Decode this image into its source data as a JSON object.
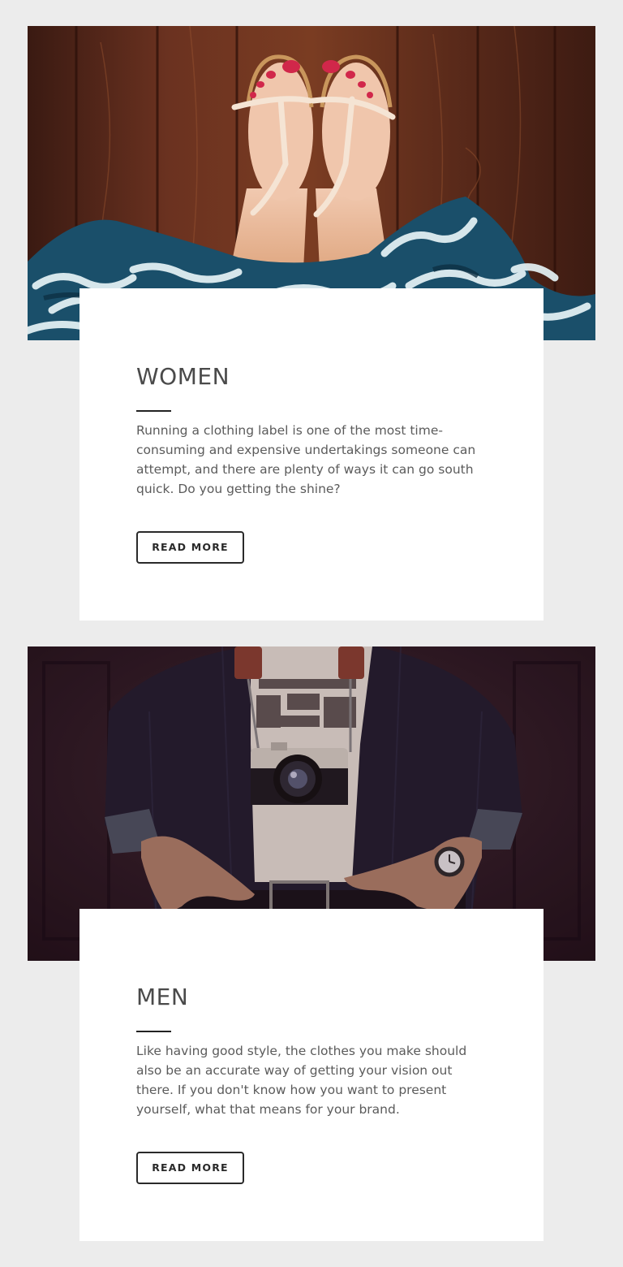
{
  "sections": [
    {
      "title": "WOMEN",
      "text": "Running a clothing label is one of the most time-consuming and expensive undertakings someone can attempt, and there are plenty of ways it can go south quick. Do you getting the shine?",
      "button_label": "READ MORE"
    },
    {
      "title": "MEN",
      "text": "Like having good style, the clothes you make should also be an accurate way of getting your vision out there. If you don't know how you want to present yourself, what that means for your brand.",
      "button_label": "READ MORE"
    }
  ],
  "colors": {
    "page_background": "#ececec",
    "card_background": "#ffffff",
    "title": "#4a4a4a",
    "body_text": "#5b5b5b",
    "button_border": "#2a2a2a"
  }
}
